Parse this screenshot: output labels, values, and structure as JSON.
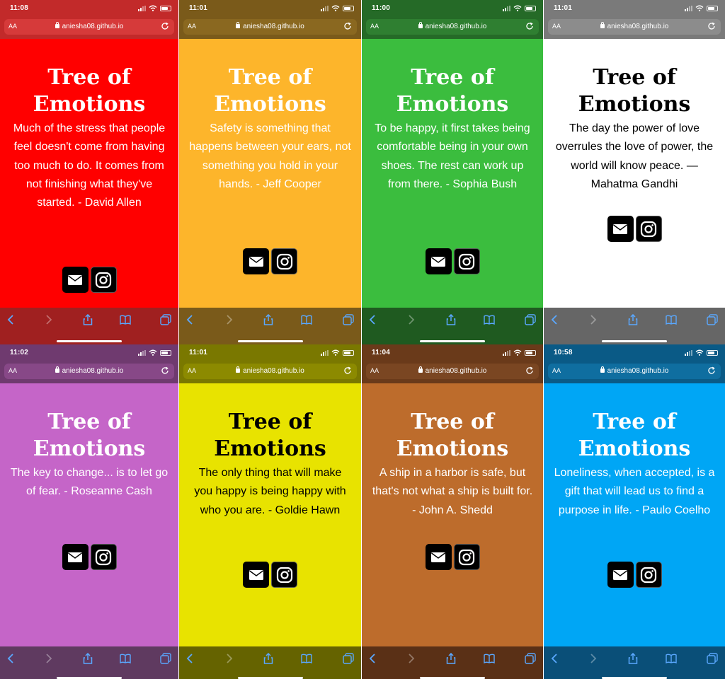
{
  "title": "Tree of Emotions",
  "url": "aniesha08.github.io",
  "aa_label": "AA",
  "screens": [
    {
      "time": "11:08",
      "quote": "Much of the stress that people feel doesn't come from having too much to do. It comes from not finishing what they've started. - David Allen",
      "bg": "#ff0000",
      "bar": "#c22a2a",
      "urlbg": "#d63a3a",
      "toolbar": "#a02020",
      "text": "#ffffff"
    },
    {
      "time": "11:01",
      "quote": "Safety is something that happens between your ears, not something you hold in your hands. - Jeff Cooper",
      "bg": "#fdb52b",
      "bar": "#7a5a1a",
      "urlbg": "#8a6820",
      "toolbar": "#7a5a1a",
      "text": "#ffffff"
    },
    {
      "time": "11:00",
      "quote": "To be happy, it first takes being comfortable being in your own shoes. The rest can work up from there. - Sophia Bush",
      "bg": "#3bbd3e",
      "bar": "#256a27",
      "urlbg": "#2f7f31",
      "toolbar": "#1f5a20",
      "text": "#ffffff"
    },
    {
      "time": "11:01",
      "quote": "The day the power of love overrules the love of power, the world will know peace. — Mahatma Gandhi",
      "bg": "#ffffff",
      "bar": "#7a7a7a",
      "urlbg": "#8c8c8c",
      "toolbar": "#666666",
      "text": "#000000"
    },
    {
      "time": "11:02",
      "quote": "The key to change... is to let go of fear. - Roseanne Cash",
      "bg": "#c565c8",
      "bar": "#6f3a6f",
      "urlbg": "#874887",
      "toolbar": "#5f3a60",
      "text": "#ffffff"
    },
    {
      "time": "11:01",
      "quote": "The only thing that will make you happy is being happy with who you are. - Goldie Hawn",
      "bg": "#e8e300",
      "bar": "#7a7800",
      "urlbg": "#8c8a00",
      "toolbar": "#656300",
      "text": "#000000"
    },
    {
      "time": "11:04",
      "quote": "A ship in a harbor is safe, but that's not what a ship is built for. - John A. Shedd",
      "bg": "#bd6c2c",
      "bar": "#6a3a1a",
      "urlbg": "#7a4622",
      "toolbar": "#5a3016",
      "text": "#ffffff"
    },
    {
      "time": "10:58",
      "quote": "Loneliness, when accepted, is a gift that will lead us to find a purpose in life. - Paulo Coelho",
      "bg": "#00a6f5",
      "bar": "#0a5a86",
      "urlbg": "#0f6ea0",
      "toolbar": "#0a4f78",
      "text": "#ffffff"
    }
  ],
  "icons": [
    "mail-icon",
    "instagram-icon"
  ],
  "toolbar_icons": [
    "back-icon",
    "forward-icon",
    "share-icon",
    "bookmarks-icon",
    "tabs-icon"
  ]
}
